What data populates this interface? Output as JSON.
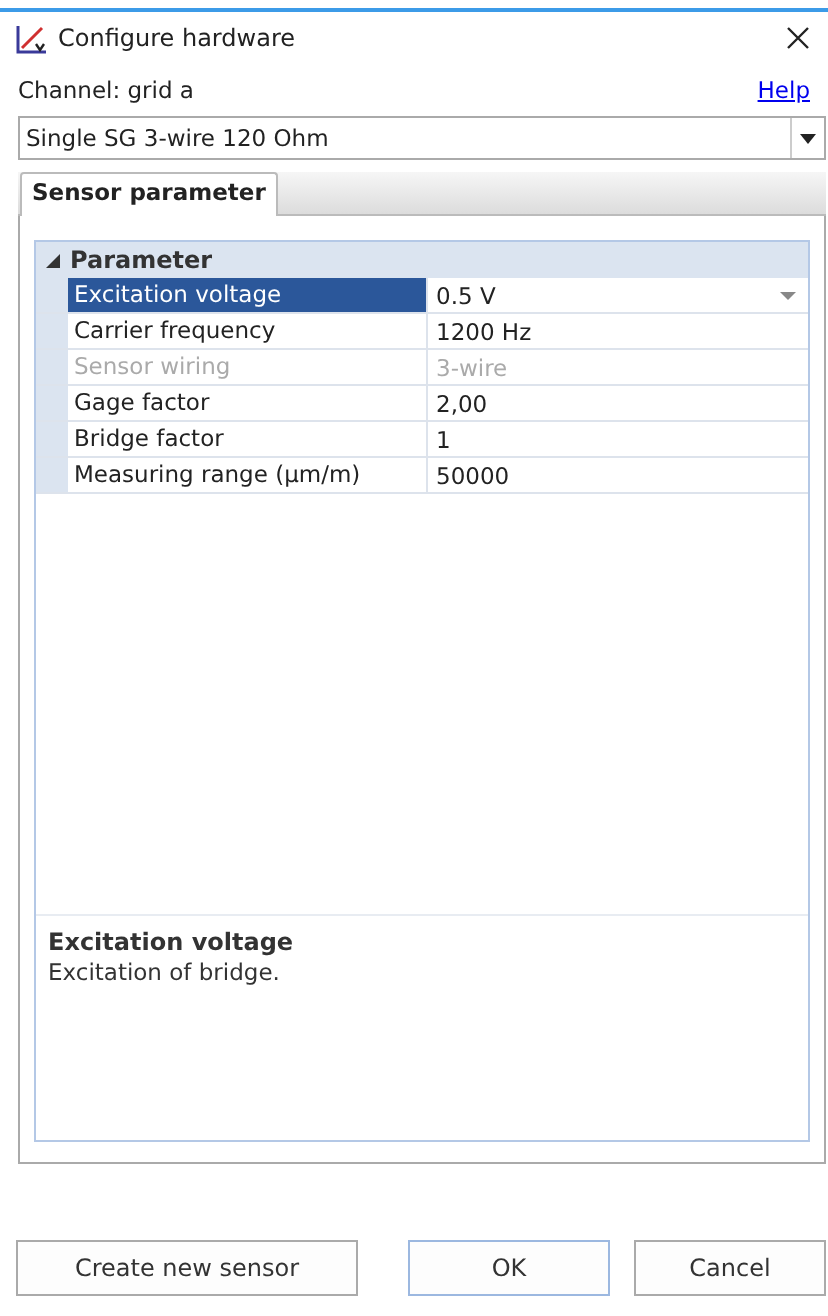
{
  "window": {
    "title": "Configure hardware"
  },
  "channel_label": "Channel: grid a",
  "help_link": "Help",
  "sensor_select": {
    "value": "Single SG 3-wire 120 Ohm"
  },
  "tabs": [
    {
      "label": "Sensor parameter",
      "selected": true
    }
  ],
  "property_grid": {
    "category": {
      "label": "Parameter",
      "expanded": true
    },
    "rows": [
      {
        "name": "Excitation voltage",
        "value": "0.5 V",
        "selected": true,
        "disabled": false
      },
      {
        "name": "Carrier frequency",
        "value": "1200 Hz",
        "selected": false,
        "disabled": false
      },
      {
        "name": "Sensor wiring",
        "value": "3-wire",
        "selected": false,
        "disabled": true
      },
      {
        "name": "Gage factor",
        "value": "2,00",
        "selected": false,
        "disabled": false
      },
      {
        "name": "Bridge factor",
        "value": "1",
        "selected": false,
        "disabled": false
      },
      {
        "name": "Measuring range (µm/m)",
        "value": "50000",
        "selected": false,
        "disabled": false
      }
    ]
  },
  "description": {
    "title": "Excitation voltage",
    "text": "Excitation of bridge."
  },
  "buttons": [
    {
      "label": "Create new sensor",
      "default": false
    },
    {
      "label": "OK",
      "default": true
    },
    {
      "label": "Cancel",
      "default": false
    }
  ]
}
